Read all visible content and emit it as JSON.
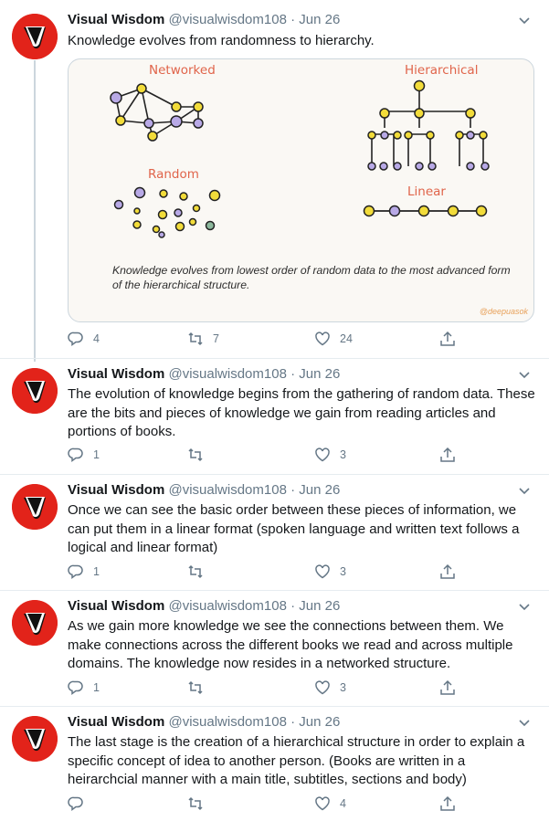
{
  "tweets": [
    {
      "name": "Visual Wisdom",
      "handle": "@visualwisdom108",
      "date": "· Jun 26",
      "text": "Knowledge evolves from randomness to hierarchy.",
      "reply_count": "4",
      "retweet_count": "7",
      "like_count": "24",
      "image": {
        "labels": {
          "networked": "Networked",
          "hierarchical": "Hierarchical",
          "random": "Random",
          "linear": "Linear"
        },
        "caption": "Knowledge evolves from lowest order of random data to the most advanced form of the hierarchical structure.",
        "credit": "@deepuasok"
      }
    },
    {
      "name": "Visual Wisdom",
      "handle": "@visualwisdom108",
      "date": "· Jun 26",
      "text": "The evolution of knowledge begins from the gathering of random data. These are the bits and pieces of knowledge we gain from reading articles and portions of books.",
      "reply_count": "1",
      "retweet_count": "",
      "like_count": "3"
    },
    {
      "name": "Visual Wisdom",
      "handle": "@visualwisdom108",
      "date": "· Jun 26",
      "text": "Once we can see the basic order between these pieces of information, we can put them in a linear format (spoken language and written text follows a logical and linear format)",
      "reply_count": "1",
      "retweet_count": "",
      "like_count": "3"
    },
    {
      "name": "Visual Wisdom",
      "handle": "@visualwisdom108",
      "date": "· Jun 26",
      "text": "As we gain more knowledge we see the connections between them. We make connections across the different books we read and across multiple domains. The knowledge now resides in a networked structure.",
      "reply_count": "1",
      "retweet_count": "",
      "like_count": "3"
    },
    {
      "name": "Visual Wisdom",
      "handle": "@visualwisdom108",
      "date": "· Jun 26",
      "text": "The last stage is the creation of a hierarchical structure in order to explain a specific concept of idea to another person. (Books are written in a heirarchcial manner with a main title, subtitles, sections and body)",
      "reply_count": "",
      "retweet_count": "",
      "like_count": "4"
    }
  ],
  "icons": {
    "reply": "reply-icon",
    "retweet": "retweet-icon",
    "like": "like-icon",
    "share": "share-icon",
    "caret": "chevron-down-icon",
    "avatar": "visual-wisdom-logo"
  },
  "colors": {
    "avatar_red": "#e2231a",
    "muted": "#657786",
    "label_orange": "#e0644a",
    "node_yellow": "#f2dc3a",
    "node_purple": "#b8a9e6",
    "node_green": "#8cb89c"
  }
}
